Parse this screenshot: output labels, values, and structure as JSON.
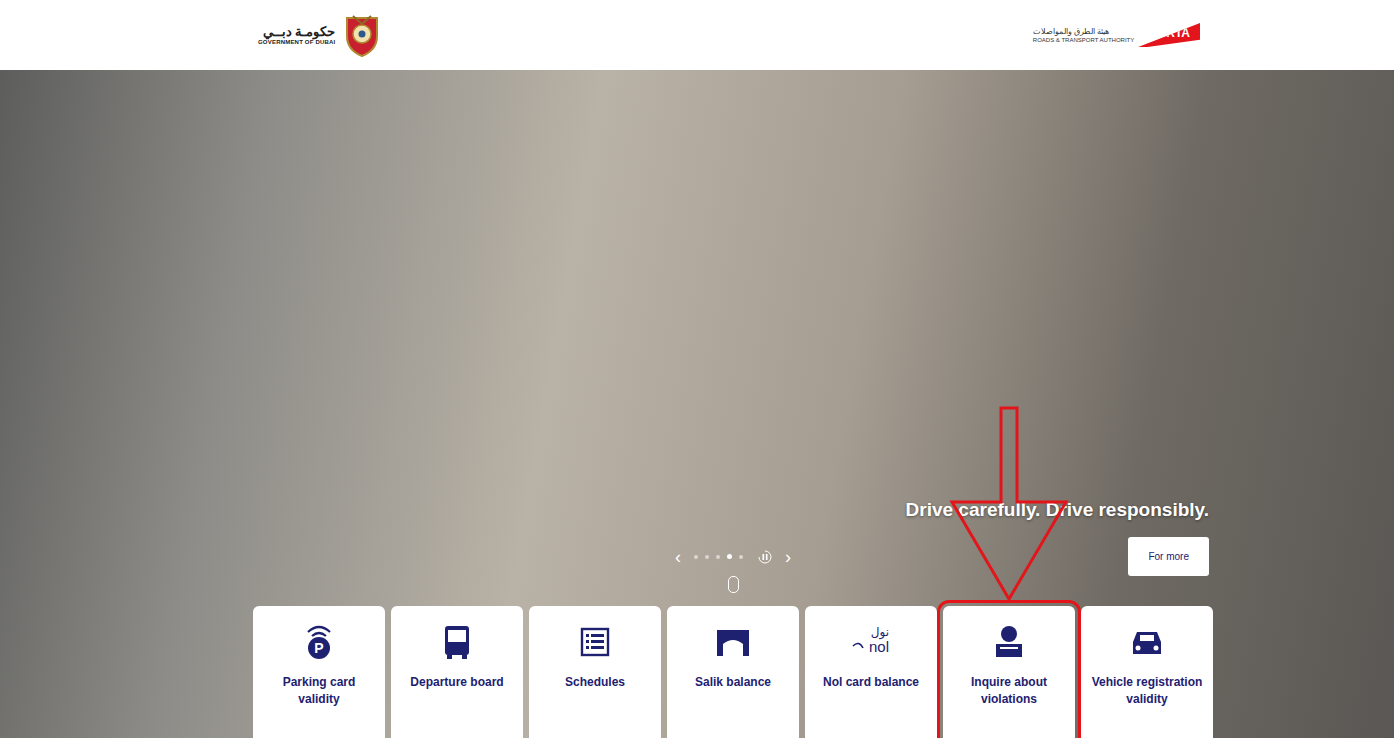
{
  "header": {
    "gov_logo": {
      "arabic": "حكومـة دبــي",
      "english": "GOVERNMENT OF DUBAI"
    },
    "rta_logo": {
      "arabic": "هيئة الطرق والمواصلات",
      "english": "ROADS & TRANSPORT AUTHORITY",
      "mark": "RTA"
    }
  },
  "hero": {
    "caption": "Drive carefully. Drive responsibly.",
    "button": "For more",
    "carousel": {
      "prev": "‹",
      "next": "›",
      "playing": true,
      "slides": [
        {
          "selected": false
        },
        {
          "selected": false
        },
        {
          "selected": false
        },
        {
          "selected": true
        },
        {
          "selected": false
        }
      ]
    }
  },
  "quick_links": [
    {
      "label": "Parking card validity",
      "kind": "parking",
      "icon_text": [
        "P"
      ],
      "annotated": false
    },
    {
      "label": "Departure board",
      "kind": "bus",
      "icon_text": [],
      "annotated": false
    },
    {
      "label": "Schedules",
      "kind": "schedule",
      "icon_text": [],
      "annotated": false
    },
    {
      "label": "Salik balance",
      "kind": "salik",
      "icon_text": [],
      "annotated": false
    },
    {
      "label": "Nol card balance",
      "kind": "nol",
      "icon_text": [
        "نول",
        "nol"
      ],
      "annotated": false
    },
    {
      "label": "Inquire about violations",
      "kind": "violations",
      "icon_text": [],
      "annotated": true
    },
    {
      "label": "Vehicle registration validity",
      "kind": "vehicle",
      "icon_text": [],
      "annotated": false
    }
  ]
}
